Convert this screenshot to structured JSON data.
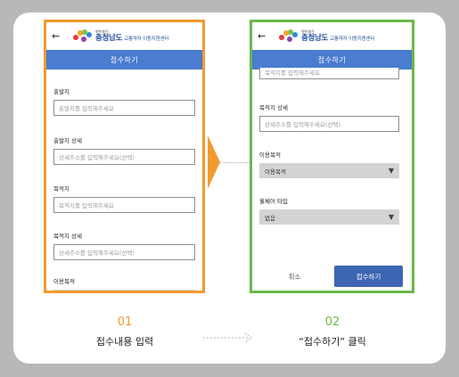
{
  "left_phone": {
    "back_glyph": "←",
    "logo_tagline": "행복충전",
    "logo_main": "충청남도",
    "logo_sub": "교통약자 이동지원센터",
    "title": "접수하기",
    "fields": [
      {
        "label": "출발지",
        "placeholder": "출발지를 입력해주세요"
      },
      {
        "label": "출발지 상세",
        "placeholder": "상세주소를 입력해주세요(선택)"
      },
      {
        "label": "목적지",
        "placeholder": "목적지를 입력해주세요"
      },
      {
        "label": "목적지 상세",
        "placeholder": "상세주소를 입력해주세요(선택)"
      }
    ],
    "purpose_label": "이용목적"
  },
  "right_phone": {
    "back_glyph": "←",
    "logo_tagline": "행복충전",
    "logo_main": "충청남도",
    "logo_sub": "교통약자 이동지원센터",
    "title": "접수하기",
    "top_placeholder": "목적지를 입력해주세요",
    "dest_detail_label": "목적지 상세",
    "dest_detail_placeholder": "상세주소를 입력해주세요(선택)",
    "purpose_label": "이용목적",
    "purpose_value": "이용목적",
    "wheelchair_label": "휠체어 타입",
    "wheelchair_value": "없음",
    "dropdown_glyph": "▼",
    "cancel_label": "취소",
    "submit_label": "접수하기"
  },
  "steps": [
    {
      "number": "01",
      "label": "접수내용 입력"
    },
    {
      "number": "02",
      "label": "“접수하기” 클릭"
    }
  ],
  "colors": {
    "step1_accent": "#f29a2e",
    "step2_accent": "#6ab947",
    "header_blue": "#4a7ccf",
    "submit_blue": "#3d66b3",
    "logo_blue": "#1f4f9c"
  }
}
